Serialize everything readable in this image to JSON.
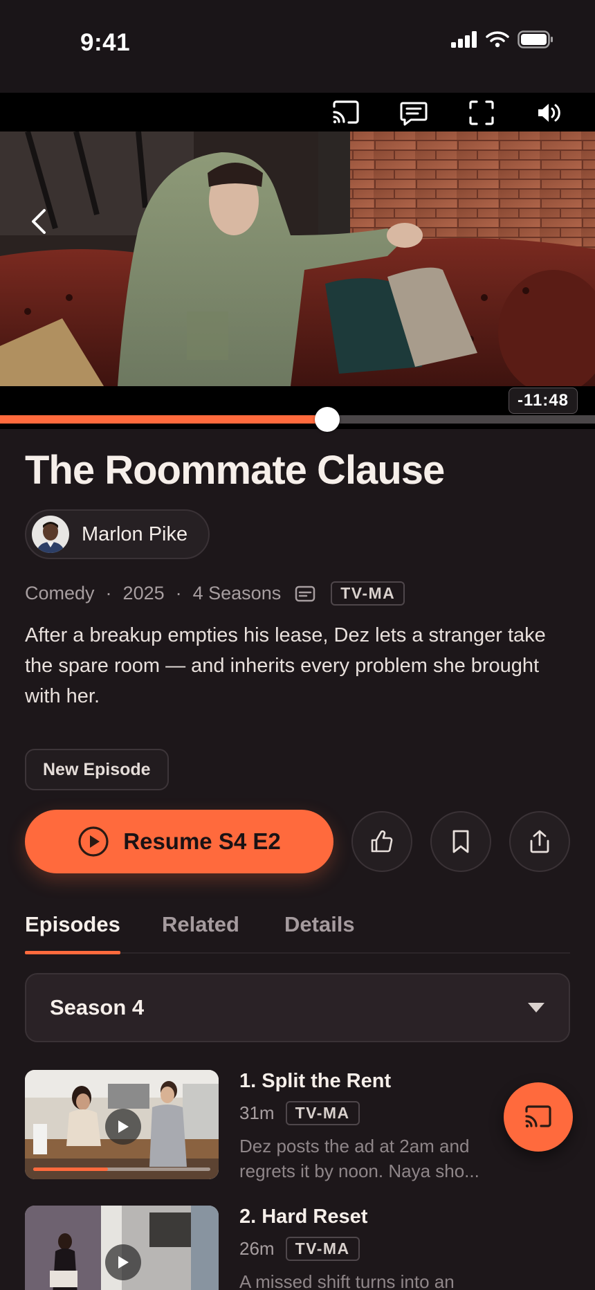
{
  "status": {
    "time": "9:41"
  },
  "player": {
    "controls": [
      {
        "name": "cast-icon"
      },
      {
        "name": "captions-icon"
      },
      {
        "name": "fullscreen-icon"
      },
      {
        "name": "volume-icon"
      }
    ],
    "remaining": "-11:48",
    "progress": 0.55
  },
  "show": {
    "title": "The Roommate Clause",
    "creator": "Marlon Pike",
    "genre": "Comedy",
    "year": "2025",
    "seasons": "4 Seasons",
    "rating": "TV-MA",
    "description": "After a breakup empties his lease, Dez lets a stranger take the spare room — and inherits every problem she brought with her.",
    "badge": "New Episode"
  },
  "actions": {
    "resume_label": "Resume S4 E2"
  },
  "tabs": [
    {
      "label": "Episodes",
      "active": true
    },
    {
      "label": "Related",
      "active": false
    },
    {
      "label": "Details",
      "active": false
    }
  ],
  "season": {
    "selected": "Season 4"
  },
  "episodes": [
    {
      "title": "1. Split the Rent",
      "duration": "31m",
      "rating": "TV-MA",
      "description": "Dez posts the ad at 2am and regrets it by noon. Naya sho...",
      "watched": 0.42
    },
    {
      "title": "2. Hard Reset",
      "duration": "26m",
      "rating": "TV-MA",
      "description": "A missed shift turns into an"
    }
  ],
  "colors": {
    "accent": "#ff6a3d",
    "background": "#1d171a"
  }
}
